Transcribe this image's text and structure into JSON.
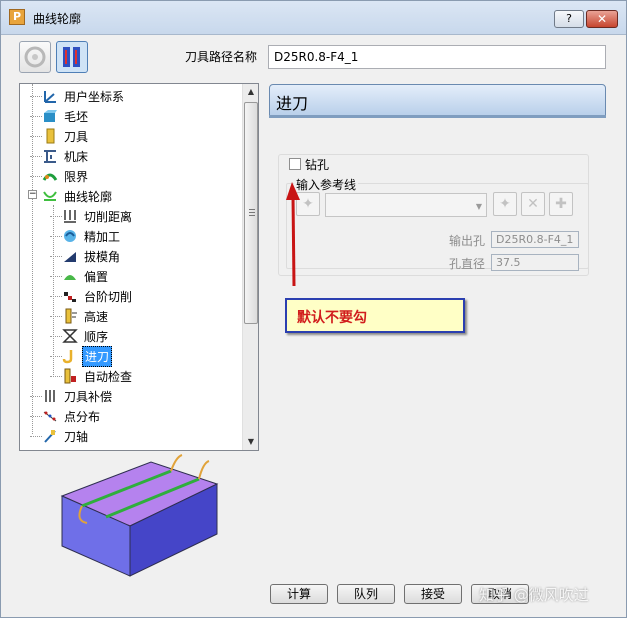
{
  "window": {
    "title": "曲线轮廓",
    "app_icon_letter": "P",
    "help_label": "?",
    "close_label": "✕"
  },
  "toolpath_name": {
    "label": "刀具路径名称",
    "value": "D25R0.8-F4_1"
  },
  "tree": {
    "items": [
      {
        "label": "用户坐标系",
        "icon": "ucs-icon",
        "level": 1
      },
      {
        "label": "毛坯",
        "icon": "block-icon",
        "level": 1
      },
      {
        "label": "刀具",
        "icon": "tool-icon",
        "level": 1
      },
      {
        "label": "机床",
        "icon": "machine-icon",
        "level": 1
      },
      {
        "label": "限界",
        "icon": "limits-icon",
        "level": 1
      },
      {
        "label": "曲线轮廓",
        "icon": "curve-profile-icon",
        "level": 1,
        "expanded": true
      },
      {
        "label": "切削距离",
        "icon": "cut-distance-icon",
        "level": 2
      },
      {
        "label": "精加工",
        "icon": "finishing-icon",
        "level": 2
      },
      {
        "label": "拔模角",
        "icon": "draft-angle-icon",
        "level": 2
      },
      {
        "label": "偏置",
        "icon": "offset-icon",
        "level": 2
      },
      {
        "label": "台阶切削",
        "icon": "step-cut-icon",
        "level": 2
      },
      {
        "label": "高速",
        "icon": "high-speed-icon",
        "level": 2
      },
      {
        "label": "顺序",
        "icon": "order-icon",
        "level": 2
      },
      {
        "label": "进刀",
        "icon": "lead-in-icon",
        "level": 2,
        "selected": true
      },
      {
        "label": "自动检查",
        "icon": "auto-check-icon",
        "level": 2
      },
      {
        "label": "刀具补偿",
        "icon": "tool-comp-icon",
        "level": 1
      },
      {
        "label": "点分布",
        "icon": "point-dist-icon",
        "level": 1
      },
      {
        "label": "刀轴",
        "icon": "tool-axis-icon",
        "level": 1
      }
    ]
  },
  "panel": {
    "title": "进刀",
    "drill_hole": {
      "label": "钻孔",
      "checked": false
    },
    "ref_line": {
      "label": "输入参考线"
    },
    "exit_hole": {
      "label": "输出孔",
      "value": "D25R0.8-F4_1"
    },
    "hole_diameter": {
      "label": "孔直径",
      "value": "37.5"
    }
  },
  "annotation": {
    "text": "默认不要勾",
    "color": "#d11d1d"
  },
  "buttons": {
    "calculate": "计算",
    "queue": "队列",
    "accept": "接受",
    "cancel": "取消"
  },
  "watermark": "知乎 @微风吹过"
}
